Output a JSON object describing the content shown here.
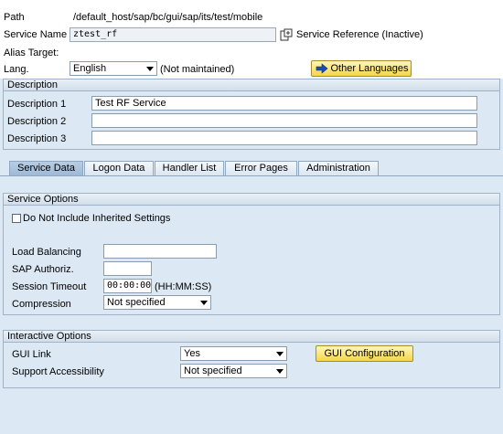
{
  "header": {
    "path_label": "Path",
    "path_value": "/default_host/sap/bc/gui/sap/its/test/mobile",
    "service_name_label": "Service Name",
    "service_name_value": "ztest_rf",
    "service_reference": "Service Reference (Inactive)",
    "alias_target_label": "Alias Target:",
    "lang_label": "Lang.",
    "lang_value": "English",
    "lang_status": "(Not maintained)",
    "other_languages_button": "Other Languages"
  },
  "description": {
    "title": "Description",
    "rows": [
      {
        "label": "Description 1",
        "value": "Test RF Service"
      },
      {
        "label": "Description 2",
        "value": ""
      },
      {
        "label": "Description 3",
        "value": ""
      }
    ]
  },
  "tabs": [
    "Service Data",
    "Logon Data",
    "Handler List",
    "Error Pages",
    "Administration"
  ],
  "service_options": {
    "title": "Service Options",
    "inherit_checkbox_label": "Do Not Include Inherited Settings",
    "inherit_checked": false,
    "load_balancing_label": "Load Balancing",
    "load_balancing_value": "",
    "sap_authoriz_label": "SAP Authoriz.",
    "sap_authoriz_value": "",
    "session_timeout_label": "Session Timeout",
    "session_timeout_value": "00:00:00",
    "session_timeout_format": "(HH:MM:SS)",
    "compression_label": "Compression",
    "compression_value": "Not specified"
  },
  "interactive_options": {
    "title": "Interactive Options",
    "gui_link_label": "GUI Link",
    "gui_link_value": "Yes",
    "support_accessibility_label": "Support Accessibility",
    "support_accessibility_value": "Not specified",
    "gui_configuration_button": "GUI Configuration"
  }
}
